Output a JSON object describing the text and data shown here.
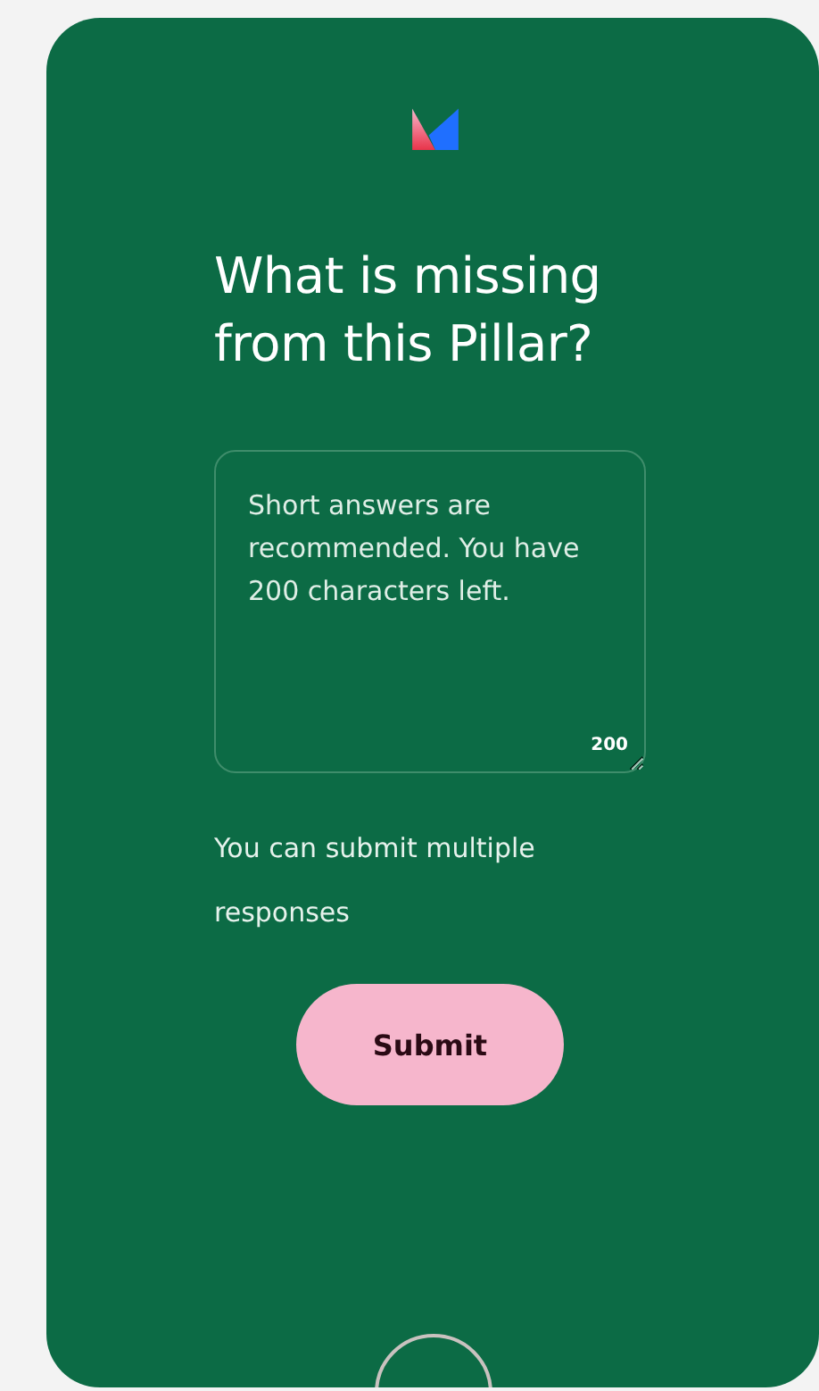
{
  "title": "What is missing from this Pillar?",
  "answer": {
    "placeholder": "Short answers are recommended. You have 200 characters left.",
    "counter": "200"
  },
  "helper": "You can submit multiple responses",
  "button": "Submit"
}
